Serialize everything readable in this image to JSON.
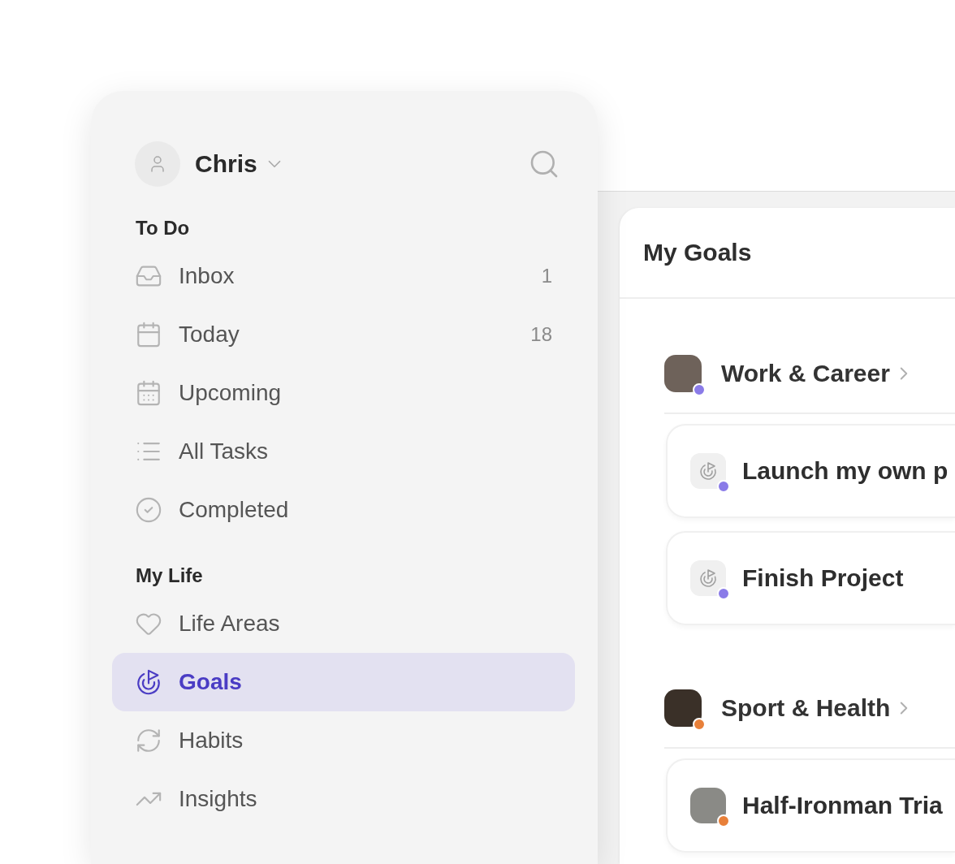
{
  "sidebar": {
    "user": {
      "name": "Chris"
    },
    "sections": [
      {
        "title": "To Do",
        "items": [
          {
            "label": "Inbox",
            "count": "1",
            "selected": false
          },
          {
            "label": "Today",
            "count": "18",
            "selected": false
          },
          {
            "label": "Upcoming",
            "selected": false
          },
          {
            "label": "All Tasks",
            "selected": false
          },
          {
            "label": "Completed",
            "selected": false
          }
        ]
      },
      {
        "title": "My Life",
        "items": [
          {
            "label": "Life Areas",
            "selected": false
          },
          {
            "label": "Goals",
            "selected": true
          },
          {
            "label": "Habits",
            "selected": false
          },
          {
            "label": "Insights",
            "selected": false
          }
        ]
      }
    ]
  },
  "main": {
    "title": "My Goals",
    "areas": [
      {
        "name": "Work & Career",
        "color": "#8a7be8",
        "goals": [
          {
            "title": "Launch my own p",
            "kind": "goal"
          },
          {
            "title": "Finish Project",
            "kind": "goal"
          }
        ]
      },
      {
        "name": "Sport & Health",
        "color": "#e8803a",
        "goals": [
          {
            "title": "Half-Ironman Tria",
            "kind": "photo"
          }
        ]
      }
    ]
  }
}
